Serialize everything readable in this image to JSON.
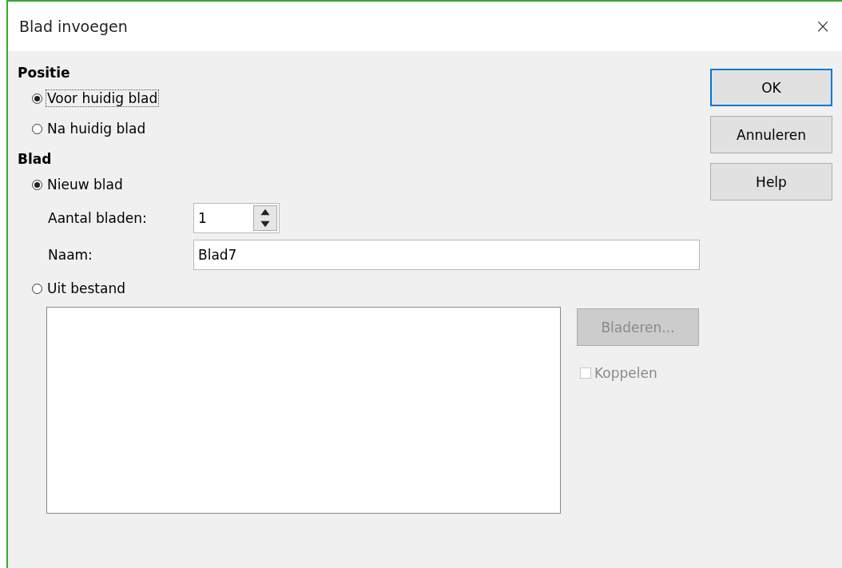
{
  "window": {
    "title": "Blad invoegen",
    "close": "×"
  },
  "position": {
    "heading": "Positie",
    "options": [
      {
        "label": "Voor huidig blad",
        "selected": true,
        "focused": true
      },
      {
        "label": "Na huidig blad",
        "selected": false,
        "focused": false
      }
    ]
  },
  "sheet": {
    "heading": "Blad",
    "new_sheet": {
      "label": "Nieuw blad",
      "selected": true
    },
    "count": {
      "label": "Aantal bladen:",
      "value": "1"
    },
    "name": {
      "label": "Naam:",
      "value": "Blad7"
    },
    "from_file": {
      "label": "Uit bestand",
      "selected": false
    },
    "browse": {
      "label": "Bladeren...",
      "disabled": true
    },
    "link": {
      "label": "Koppelen",
      "checked": false,
      "disabled": true
    }
  },
  "buttons": [
    {
      "label": "OK",
      "default": true
    },
    {
      "label": "Annuleren",
      "default": false
    },
    {
      "label": "Help",
      "default": false
    }
  ]
}
